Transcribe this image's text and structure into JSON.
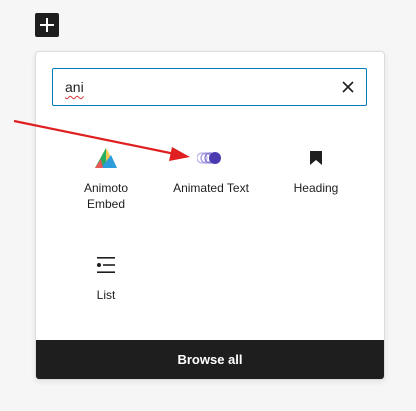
{
  "search": {
    "value": "ani"
  },
  "blocks": [
    {
      "label": "Animoto\nEmbed",
      "icon": "animoto-icon"
    },
    {
      "label": "Animated Text",
      "icon": "animated-text-icon"
    },
    {
      "label": "Heading",
      "icon": "bookmark-heading-icon"
    },
    {
      "label": "List",
      "icon": "list-icon"
    }
  ],
  "footer": {
    "browse_all_label": "Browse all"
  },
  "colors": {
    "accent": "#007cba",
    "dark": "#1e1e1e",
    "annotation_arrow": "#e02020",
    "animated_text_icon": "#4b3bb0"
  }
}
